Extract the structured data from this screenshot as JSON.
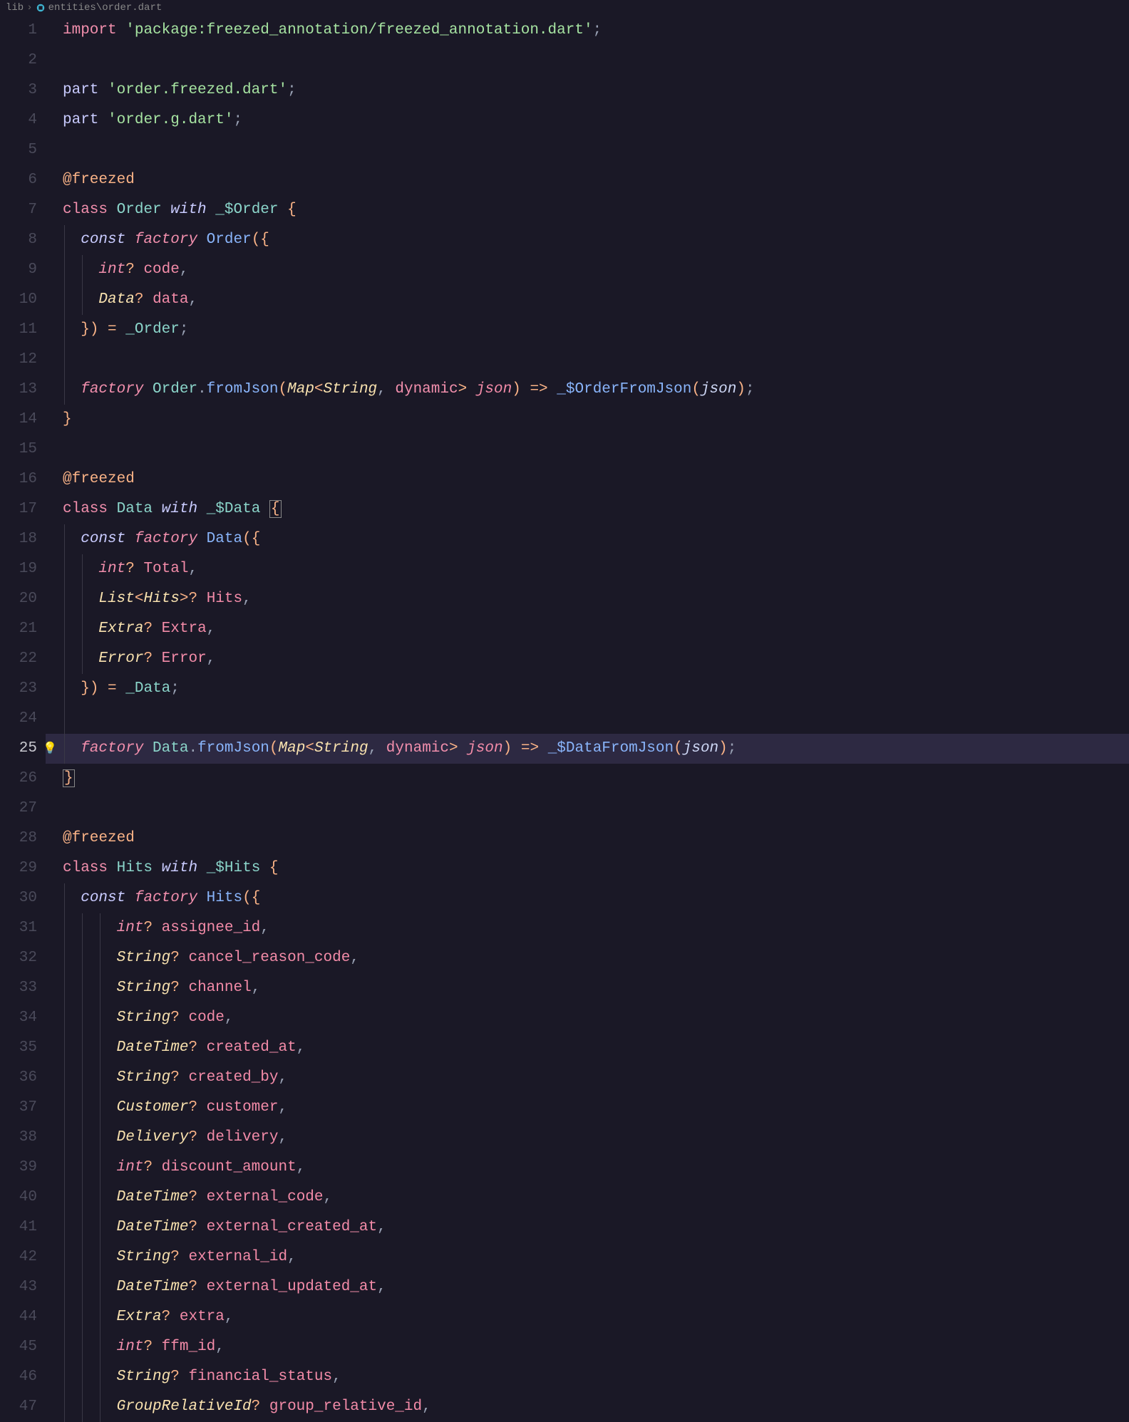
{
  "breadcrumb": {
    "folder": "lib",
    "file": "entities\\order.dart"
  },
  "active_line": "25",
  "lines": {
    "l1": [
      [
        "kw-import",
        "import"
      ],
      [
        "punct",
        " "
      ],
      [
        "str",
        "'package:freezed_annotation/freezed_annotation.dart'"
      ],
      [
        "punct",
        ";"
      ]
    ],
    "l2": [],
    "l3": [
      [
        "kw-part",
        "part"
      ],
      [
        "punct",
        " "
      ],
      [
        "str",
        "'order.freezed.dart'"
      ],
      [
        "punct",
        ";"
      ]
    ],
    "l4": [
      [
        "kw-part",
        "part"
      ],
      [
        "punct",
        " "
      ],
      [
        "str",
        "'order.g.dart'"
      ],
      [
        "punct",
        ";"
      ]
    ],
    "l5": [],
    "l6": [
      [
        "annotation",
        "@freezed"
      ]
    ],
    "l7": [
      [
        "kw-class",
        "class"
      ],
      [
        "punct",
        " "
      ],
      [
        "type",
        "Order"
      ],
      [
        "punct",
        " "
      ],
      [
        "kw-with",
        "with"
      ],
      [
        "punct",
        " "
      ],
      [
        "type",
        "_$Order"
      ],
      [
        "punct",
        " "
      ],
      [
        "op-y",
        "{"
      ]
    ],
    "l8": [
      [
        "punct",
        "  "
      ],
      [
        "kw-const",
        "const"
      ],
      [
        "punct",
        " "
      ],
      [
        "kw-factory",
        "factory"
      ],
      [
        "punct",
        " "
      ],
      [
        "fn",
        "Order"
      ],
      [
        "op-y",
        "({"
      ]
    ],
    "l9": [
      [
        "punct",
        "    "
      ],
      [
        "kw-int",
        "int"
      ],
      [
        "op-y",
        "?"
      ],
      [
        "punct",
        " "
      ],
      [
        "param",
        "code"
      ],
      [
        "punct",
        ","
      ]
    ],
    "l10": [
      [
        "punct",
        "    "
      ],
      [
        "type-i",
        "Data"
      ],
      [
        "op-y",
        "?"
      ],
      [
        "punct",
        " "
      ],
      [
        "param",
        "data"
      ],
      [
        "punct",
        ","
      ]
    ],
    "l11": [
      [
        "punct",
        "  "
      ],
      [
        "op-y",
        "})"
      ],
      [
        "punct",
        " "
      ],
      [
        "op-y",
        "="
      ],
      [
        "punct",
        " "
      ],
      [
        "type",
        "_Order"
      ],
      [
        "punct",
        ";"
      ]
    ],
    "l12": [],
    "l13": [
      [
        "punct",
        "  "
      ],
      [
        "kw-factory",
        "factory"
      ],
      [
        "punct",
        " "
      ],
      [
        "type",
        "Order"
      ],
      [
        "punct",
        "."
      ],
      [
        "fn",
        "fromJson"
      ],
      [
        "op-y",
        "("
      ],
      [
        "type-i",
        "Map"
      ],
      [
        "op-y",
        "<"
      ],
      [
        "type-i",
        "String"
      ],
      [
        "punct",
        ", "
      ],
      [
        "kw-dynamic",
        "dynamic"
      ],
      [
        "op-y",
        ">"
      ],
      [
        "punct",
        " "
      ],
      [
        "param-i",
        "json"
      ],
      [
        "op-y",
        ")"
      ],
      [
        "punct",
        " "
      ],
      [
        "op-y",
        "=>"
      ],
      [
        "punct",
        " "
      ],
      [
        "fn",
        "_$OrderFromJson"
      ],
      [
        "op-y",
        "("
      ],
      [
        "ident-i",
        "json"
      ],
      [
        "op-y",
        ")"
      ],
      [
        "punct",
        ";"
      ]
    ],
    "l14": [
      [
        "op-y",
        "}"
      ]
    ],
    "l15": [],
    "l16": [
      [
        "annotation",
        "@freezed"
      ]
    ],
    "l17": [
      [
        "kw-class",
        "class"
      ],
      [
        "punct",
        " "
      ],
      [
        "type",
        "Data"
      ],
      [
        "punct",
        " "
      ],
      [
        "kw-with",
        "with"
      ],
      [
        "punct",
        " "
      ],
      [
        "type",
        "_$Data"
      ],
      [
        "punct",
        " "
      ],
      [
        "op-y box-char",
        "{"
      ]
    ],
    "l18": [
      [
        "punct",
        "  "
      ],
      [
        "kw-const",
        "const"
      ],
      [
        "punct",
        " "
      ],
      [
        "kw-factory",
        "factory"
      ],
      [
        "punct",
        " "
      ],
      [
        "fn",
        "Data"
      ],
      [
        "op-y",
        "({"
      ]
    ],
    "l19": [
      [
        "punct",
        "    "
      ],
      [
        "kw-int",
        "int"
      ],
      [
        "op-y",
        "?"
      ],
      [
        "punct",
        " "
      ],
      [
        "param",
        "Total"
      ],
      [
        "punct",
        ","
      ]
    ],
    "l20": [
      [
        "punct",
        "    "
      ],
      [
        "type-i",
        "List"
      ],
      [
        "op-y",
        "<"
      ],
      [
        "type-i",
        "Hits"
      ],
      [
        "op-y",
        ">?"
      ],
      [
        "punct",
        " "
      ],
      [
        "param",
        "Hits"
      ],
      [
        "punct",
        ","
      ]
    ],
    "l21": [
      [
        "punct",
        "    "
      ],
      [
        "type-i",
        "Extra"
      ],
      [
        "op-y",
        "?"
      ],
      [
        "punct",
        " "
      ],
      [
        "param",
        "Extra"
      ],
      [
        "punct",
        ","
      ]
    ],
    "l22": [
      [
        "punct",
        "    "
      ],
      [
        "type-i",
        "Error"
      ],
      [
        "op-y",
        "?"
      ],
      [
        "punct",
        " "
      ],
      [
        "param",
        "Error"
      ],
      [
        "punct",
        ","
      ]
    ],
    "l23": [
      [
        "punct",
        "  "
      ],
      [
        "op-y",
        "})"
      ],
      [
        "punct",
        " "
      ],
      [
        "op-y",
        "="
      ],
      [
        "punct",
        " "
      ],
      [
        "type",
        "_Data"
      ],
      [
        "punct",
        ";"
      ]
    ],
    "l24": [],
    "l25": [
      [
        "punct",
        "  "
      ],
      [
        "kw-factory",
        "factory"
      ],
      [
        "punct",
        " "
      ],
      [
        "type",
        "Data"
      ],
      [
        "punct",
        "."
      ],
      [
        "fn",
        "fromJson"
      ],
      [
        "op-y",
        "("
      ],
      [
        "type-i",
        "Map"
      ],
      [
        "op-y",
        "<"
      ],
      [
        "type-i",
        "String"
      ],
      [
        "punct",
        ", "
      ],
      [
        "kw-dynamic",
        "dynamic"
      ],
      [
        "op-y",
        ">"
      ],
      [
        "punct",
        " "
      ],
      [
        "param-i",
        "json"
      ],
      [
        "op-y",
        ")"
      ],
      [
        "punct",
        " "
      ],
      [
        "op-y",
        "=>"
      ],
      [
        "punct",
        " "
      ],
      [
        "fn",
        "_$DataFromJson"
      ],
      [
        "op-y",
        "("
      ],
      [
        "ident-i",
        "json"
      ],
      [
        "op-y",
        ")"
      ],
      [
        "punct",
        ";"
      ]
    ],
    "l26": [
      [
        "op-y box-char",
        "}"
      ]
    ],
    "l27": [],
    "l28": [
      [
        "annotation",
        "@freezed"
      ]
    ],
    "l29": [
      [
        "kw-class",
        "class"
      ],
      [
        "punct",
        " "
      ],
      [
        "type",
        "Hits"
      ],
      [
        "punct",
        " "
      ],
      [
        "kw-with",
        "with"
      ],
      [
        "punct",
        " "
      ],
      [
        "type",
        "_$Hits"
      ],
      [
        "punct",
        " "
      ],
      [
        "op-y",
        "{"
      ]
    ],
    "l30": [
      [
        "punct",
        "  "
      ],
      [
        "kw-const",
        "const"
      ],
      [
        "punct",
        " "
      ],
      [
        "kw-factory",
        "factory"
      ],
      [
        "punct",
        " "
      ],
      [
        "fn",
        "Hits"
      ],
      [
        "op-y",
        "({"
      ]
    ],
    "l31": [
      [
        "punct",
        "      "
      ],
      [
        "kw-int",
        "int"
      ],
      [
        "op-y",
        "?"
      ],
      [
        "punct",
        " "
      ],
      [
        "param",
        "assignee_id"
      ],
      [
        "punct",
        ","
      ]
    ],
    "l32": [
      [
        "punct",
        "      "
      ],
      [
        "type-i",
        "String"
      ],
      [
        "op-y",
        "?"
      ],
      [
        "punct",
        " "
      ],
      [
        "param",
        "cancel_reason_code"
      ],
      [
        "punct",
        ","
      ]
    ],
    "l33": [
      [
        "punct",
        "      "
      ],
      [
        "type-i",
        "String"
      ],
      [
        "op-y",
        "?"
      ],
      [
        "punct",
        " "
      ],
      [
        "param",
        "channel"
      ],
      [
        "punct",
        ","
      ]
    ],
    "l34": [
      [
        "punct",
        "      "
      ],
      [
        "type-i",
        "String"
      ],
      [
        "op-y",
        "?"
      ],
      [
        "punct",
        " "
      ],
      [
        "param",
        "code"
      ],
      [
        "punct",
        ","
      ]
    ],
    "l35": [
      [
        "punct",
        "      "
      ],
      [
        "type-i",
        "DateTime"
      ],
      [
        "op-y",
        "?"
      ],
      [
        "punct",
        " "
      ],
      [
        "param",
        "created_at"
      ],
      [
        "punct",
        ","
      ]
    ],
    "l36": [
      [
        "punct",
        "      "
      ],
      [
        "type-i",
        "String"
      ],
      [
        "op-y",
        "?"
      ],
      [
        "punct",
        " "
      ],
      [
        "param",
        "created_by"
      ],
      [
        "punct",
        ","
      ]
    ],
    "l37": [
      [
        "punct",
        "      "
      ],
      [
        "type-i",
        "Customer"
      ],
      [
        "op-y",
        "?"
      ],
      [
        "punct",
        " "
      ],
      [
        "param",
        "customer"
      ],
      [
        "punct",
        ","
      ]
    ],
    "l38": [
      [
        "punct",
        "      "
      ],
      [
        "type-i",
        "Delivery"
      ],
      [
        "op-y",
        "?"
      ],
      [
        "punct",
        " "
      ],
      [
        "param",
        "delivery"
      ],
      [
        "punct",
        ","
      ]
    ],
    "l39": [
      [
        "punct",
        "      "
      ],
      [
        "kw-int",
        "int"
      ],
      [
        "op-y",
        "?"
      ],
      [
        "punct",
        " "
      ],
      [
        "param",
        "discount_amount"
      ],
      [
        "punct",
        ","
      ]
    ],
    "l40": [
      [
        "punct",
        "      "
      ],
      [
        "type-i",
        "DateTime"
      ],
      [
        "op-y",
        "?"
      ],
      [
        "punct",
        " "
      ],
      [
        "param",
        "external_code"
      ],
      [
        "punct",
        ","
      ]
    ],
    "l41": [
      [
        "punct",
        "      "
      ],
      [
        "type-i",
        "DateTime"
      ],
      [
        "op-y",
        "?"
      ],
      [
        "punct",
        " "
      ],
      [
        "param",
        "external_created_at"
      ],
      [
        "punct",
        ","
      ]
    ],
    "l42": [
      [
        "punct",
        "      "
      ],
      [
        "type-i",
        "String"
      ],
      [
        "op-y",
        "?"
      ],
      [
        "punct",
        " "
      ],
      [
        "param",
        "external_id"
      ],
      [
        "punct",
        ","
      ]
    ],
    "l43": [
      [
        "punct",
        "      "
      ],
      [
        "type-i",
        "DateTime"
      ],
      [
        "op-y",
        "?"
      ],
      [
        "punct",
        " "
      ],
      [
        "param",
        "external_updated_at"
      ],
      [
        "punct",
        ","
      ]
    ],
    "l44": [
      [
        "punct",
        "      "
      ],
      [
        "type-i",
        "Extra"
      ],
      [
        "op-y",
        "?"
      ],
      [
        "punct",
        " "
      ],
      [
        "param",
        "extra"
      ],
      [
        "punct",
        ","
      ]
    ],
    "l45": [
      [
        "punct",
        "      "
      ],
      [
        "kw-int",
        "int"
      ],
      [
        "op-y",
        "?"
      ],
      [
        "punct",
        " "
      ],
      [
        "param",
        "ffm_id"
      ],
      [
        "punct",
        ","
      ]
    ],
    "l46": [
      [
        "punct",
        "      "
      ],
      [
        "type-i",
        "String"
      ],
      [
        "op-y",
        "?"
      ],
      [
        "punct",
        " "
      ],
      [
        "param",
        "financial_status"
      ],
      [
        "punct",
        ","
      ]
    ],
    "l47": [
      [
        "punct",
        "      "
      ],
      [
        "type-i",
        "GroupRelativeId"
      ],
      [
        "op-y",
        "?"
      ],
      [
        "punct",
        " "
      ],
      [
        "param",
        "group_relative_id"
      ],
      [
        "punct",
        ","
      ]
    ]
  },
  "guide_levels": {
    "l8": [
      0
    ],
    "l9": [
      0,
      1
    ],
    "l10": [
      0,
      1
    ],
    "l11": [
      0
    ],
    "l12": [
      0
    ],
    "l13": [
      0
    ],
    "l18": [
      0
    ],
    "l19": [
      0,
      1
    ],
    "l20": [
      0,
      1
    ],
    "l21": [
      0,
      1
    ],
    "l22": [
      0,
      1
    ],
    "l23": [
      0
    ],
    "l24": [
      0
    ],
    "l25": [
      0
    ],
    "l30": [
      0
    ],
    "l31": [
      0,
      1,
      2
    ],
    "l32": [
      0,
      1,
      2
    ],
    "l33": [
      0,
      1,
      2
    ],
    "l34": [
      0,
      1,
      2
    ],
    "l35": [
      0,
      1,
      2
    ],
    "l36": [
      0,
      1,
      2
    ],
    "l37": [
      0,
      1,
      2
    ],
    "l38": [
      0,
      1,
      2
    ],
    "l39": [
      0,
      1,
      2
    ],
    "l40": [
      0,
      1,
      2
    ],
    "l41": [
      0,
      1,
      2
    ],
    "l42": [
      0,
      1,
      2
    ],
    "l43": [
      0,
      1,
      2
    ],
    "l44": [
      0,
      1,
      2
    ],
    "l45": [
      0,
      1,
      2
    ],
    "l46": [
      0,
      1,
      2
    ],
    "l47": [
      0,
      1,
      2
    ]
  },
  "bulb_line": "25"
}
